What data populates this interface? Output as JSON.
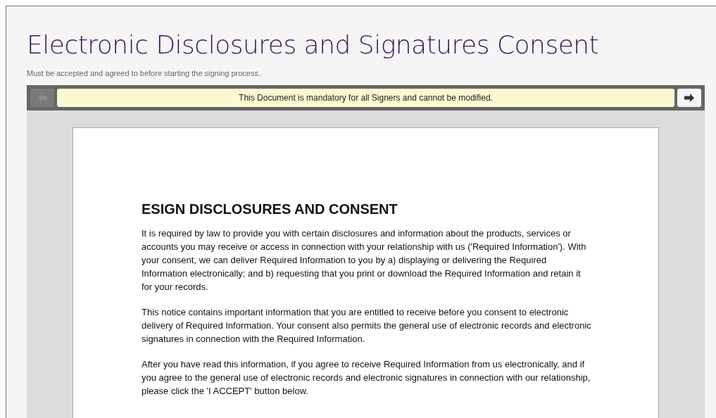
{
  "page": {
    "title": "Electronic Disclosures and Signatures Consent",
    "subtitle": "Must be accepted and agreed to before starting the signing process."
  },
  "toolbar": {
    "previous_button": {
      "disabled": true
    },
    "notice": "This Document is mandatory for all Signers and cannot be modified.",
    "next_button": {
      "disabled": false
    }
  },
  "document": {
    "heading": "ESIGN DISCLOSURES AND CONSENT",
    "paragraphs": [
      "It is required by law to provide you with certain disclosures and information about the products, services or accounts you may receive or access in connection with your relationship with us ('Required Information'). With your consent, we can deliver Required Information to you by a) displaying or delivering the Required Information electronically; and b) requesting that you print or download the Required Information and retain it for your records.",
      "This notice contains important information that you are entitled to receive before you consent to electronic delivery of Required Information. Your consent also permits the general use of electronic records and electronic signatures in connection with the Required Information.",
      "After you have read this information, if you agree to receive Required Information from us electronically, and if you agree to the general use of electronic records and electronic signatures in connection with our relationship, please click the 'I ACCEPT' button below."
    ]
  }
}
